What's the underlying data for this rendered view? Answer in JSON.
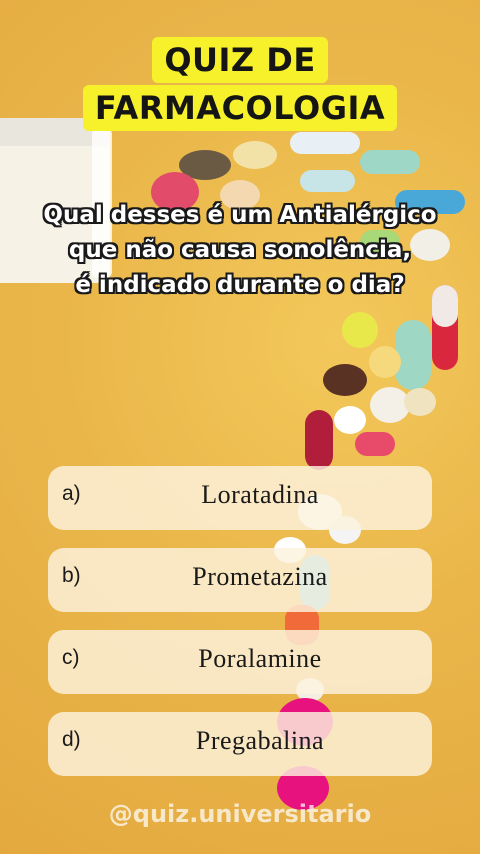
{
  "title": {
    "line1": "QUIZ DE",
    "line2": "FARMACOLOGIA"
  },
  "question": {
    "line1": "Qual desses é um Antialérgico",
    "line2": "que não causa sonolência,",
    "line3": "é indicado durante o dia?"
  },
  "options": [
    {
      "letter": "a)",
      "text": "Loratadina"
    },
    {
      "letter": "b)",
      "text": "Prometazina"
    },
    {
      "letter": "c)",
      "text": "Poralamine"
    },
    {
      "letter": "d)",
      "text": "Pregabalina"
    }
  ],
  "footer": {
    "handle": "@quiz.universitario"
  },
  "colors": {
    "title_highlight": "#f6f12a",
    "background": "#eab64a",
    "option_bg": "#fdf3de"
  }
}
